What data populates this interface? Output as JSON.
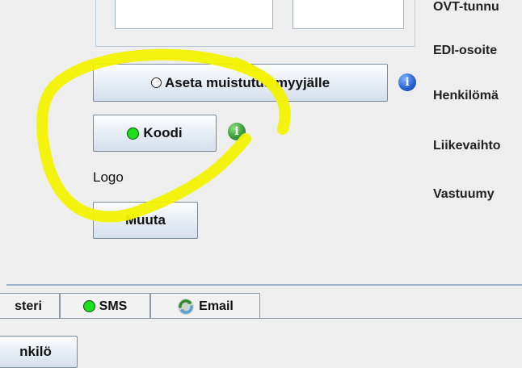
{
  "right_labels": {
    "ovt": "OVT-tunnu",
    "edi": "EDI-osoite",
    "henkilo": "Henkilömä",
    "liikevaihto": "Liikevaihto",
    "vastuu": "Vastuumy"
  },
  "reminder_button": {
    "label": "Aseta muistutus myyjälle"
  },
  "code_button": {
    "label": "Koodi"
  },
  "logo": {
    "label": "Logo",
    "change_button": "Muuta"
  },
  "tabs": [
    {
      "label": "steri"
    },
    {
      "label": "SMS"
    },
    {
      "label": "Email"
    }
  ],
  "bottom_button": {
    "label": "nkilö"
  },
  "colors": {
    "highlight": "#f2f200",
    "status_green": "#1ee01e",
    "info_blue": "#2a67d6"
  }
}
